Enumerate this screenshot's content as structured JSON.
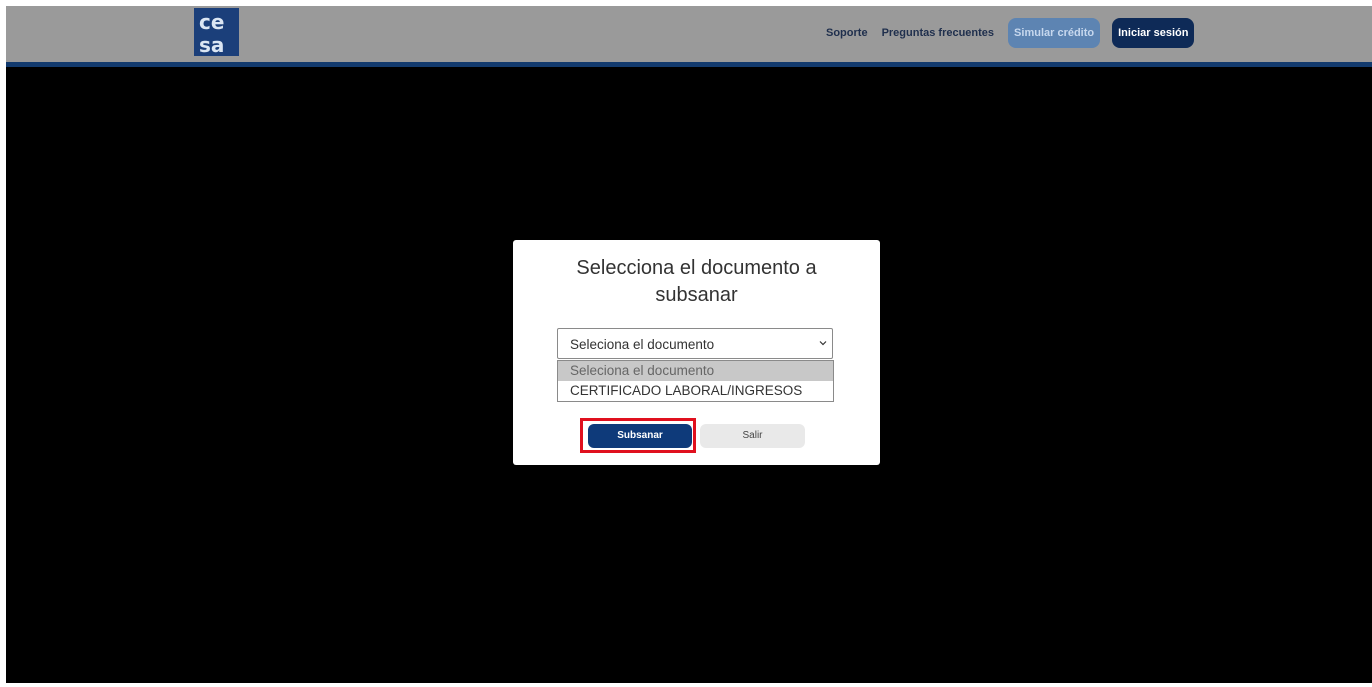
{
  "header": {
    "logo_text": "cesa",
    "nav": {
      "support": "Soporte",
      "faq": "Preguntas frecuentes",
      "simulate": "Simular crédito",
      "login": "Iniciar sesión"
    }
  },
  "modal": {
    "title": "Selecciona el documento a subsanar",
    "select": {
      "value": "Seleciona el documento",
      "options": [
        "Seleciona el documento",
        "CERTIFICADO LABORAL/INGRESOS"
      ]
    },
    "buttons": {
      "submit": "Subsanar",
      "exit": "Salir"
    }
  },
  "colors": {
    "brand_dark": "#0e2a57",
    "brand_blue": "#0e3a7a",
    "highlight": "#e0101e"
  }
}
